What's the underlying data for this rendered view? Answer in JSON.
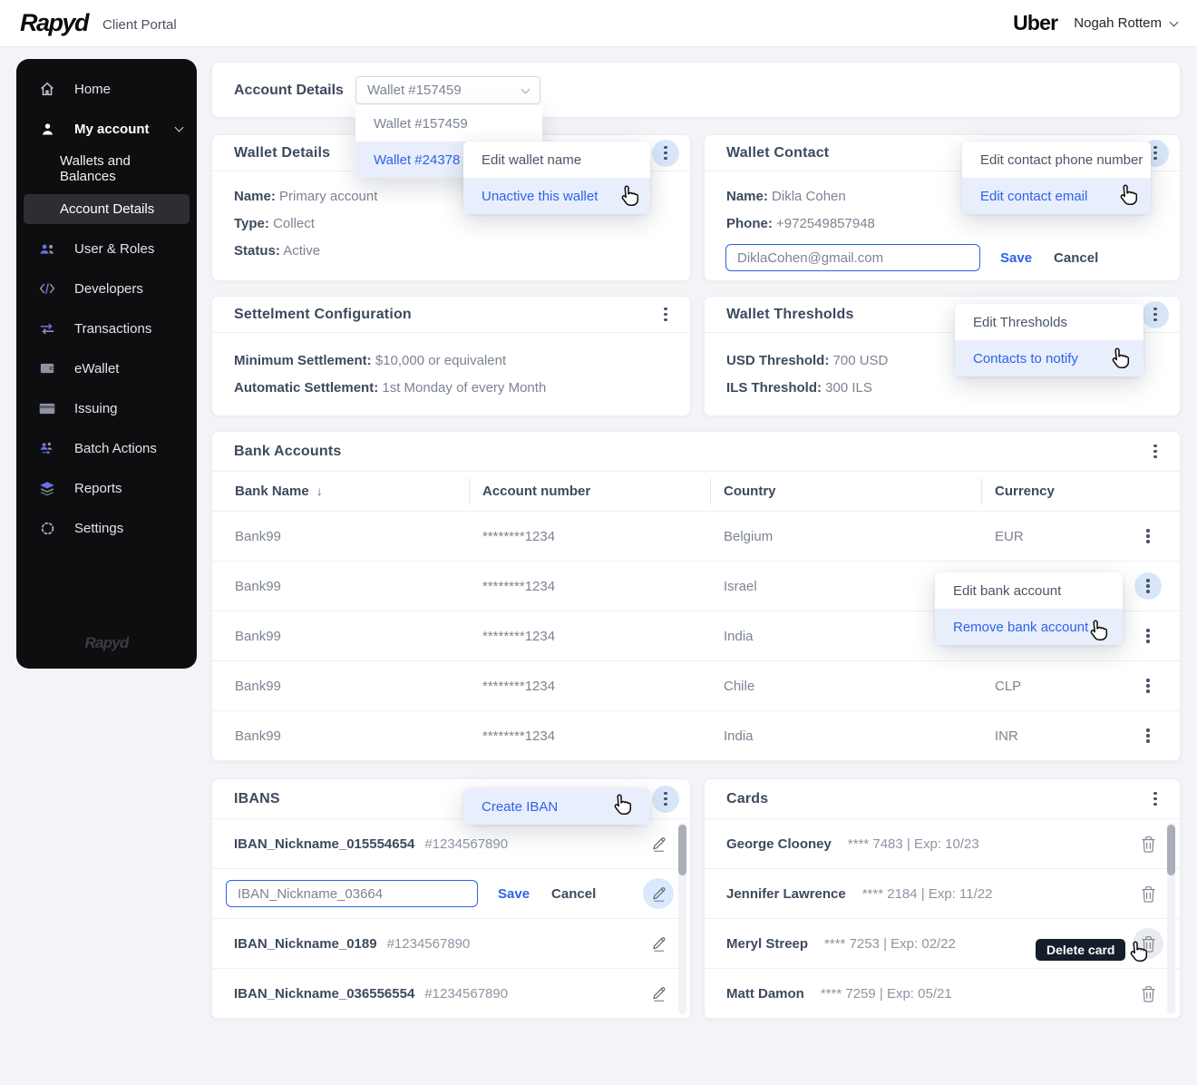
{
  "header": {
    "logo": "Rapyd",
    "portal_title": "Client Portal",
    "org_logo": "Uber",
    "user_name": "Nogah Rottem"
  },
  "sidebar": {
    "items": [
      {
        "label": "Home",
        "icon": "home-icon"
      },
      {
        "label": "My account",
        "icon": "user-icon",
        "expanded": true
      },
      {
        "label": "Wallets and Balances",
        "sub": true
      },
      {
        "label": "Account Details",
        "sub": true,
        "active": true
      },
      {
        "label": "User & Roles",
        "icon": "users-icon"
      },
      {
        "label": "Developers",
        "icon": "code-icon"
      },
      {
        "label": "Transactions",
        "icon": "transfer-icon"
      },
      {
        "label": "eWallet",
        "icon": "wallet-icon"
      },
      {
        "label": "Issuing",
        "icon": "card-icon"
      },
      {
        "label": "Batch Actions",
        "icon": "batch-icon"
      },
      {
        "label": "Reports",
        "icon": "layers-icon"
      },
      {
        "label": "Settings",
        "icon": "gear-icon"
      }
    ],
    "footer_logo": "Rapyd"
  },
  "account_details": {
    "title": "Account Details",
    "selected_wallet": "Wallet #157459",
    "options": [
      {
        "label": "Wallet #157459",
        "highlighted": false
      },
      {
        "label": "Wallet #24378",
        "highlighted": true
      }
    ]
  },
  "wallet_details": {
    "title": "Wallet Details",
    "name_label": "Name:",
    "name": "Primary account",
    "type_label": "Type:",
    "type": "Collect",
    "status_label": "Status:",
    "status": "Active",
    "menu": [
      {
        "label": "Edit wallet name",
        "highlighted": false
      },
      {
        "label": "Unactive this wallet",
        "highlighted": true
      }
    ]
  },
  "wallet_contact": {
    "title": "Wallet Contact",
    "name_label": "Name:",
    "name": "Dikla Cohen",
    "phone_label": "Phone:",
    "phone": "+972549857948",
    "email_value": "DiklaCohen@gmail.com",
    "save_label": "Save",
    "cancel_label": "Cancel",
    "menu": [
      {
        "label": "Edit contact phone number",
        "highlighted": false
      },
      {
        "label": "Edit contact email",
        "highlighted": true
      }
    ]
  },
  "settlement": {
    "title": "Settelment Configuration",
    "rows": [
      {
        "label": "Minimum Settlement:",
        "value": "$10,000 or equivalent"
      },
      {
        "label": "Automatic Settlement:",
        "value": "1st Monday of every Month"
      }
    ]
  },
  "thresholds": {
    "title": "Wallet Thresholds",
    "rows": [
      {
        "label": "USD Threshold:",
        "value": "700 USD"
      },
      {
        "label": "ILS Threshold:",
        "value": "300 ILS"
      }
    ],
    "menu": [
      {
        "label": "Edit Thresholds",
        "highlighted": false
      },
      {
        "label": "Contacts to notify",
        "highlighted": true
      }
    ]
  },
  "bank_accounts": {
    "title": "Bank Accounts",
    "columns": [
      "Bank Name",
      "Account number",
      "Country",
      "Currency"
    ],
    "sort_column": "Bank Name",
    "sort_icon": "arrow-down",
    "rows": [
      [
        "Bank99",
        "********1234",
        "Belgium",
        "EUR"
      ],
      [
        "Bank99",
        "********1234",
        "Israel",
        ""
      ],
      [
        "Bank99",
        "********1234",
        "India",
        ""
      ],
      [
        "Bank99",
        "********1234",
        "Chile",
        "CLP"
      ],
      [
        "Bank99",
        "********1234",
        "India",
        "INR"
      ]
    ],
    "menu": [
      {
        "label": "Edit bank account",
        "highlighted": false
      },
      {
        "label": "Remove bank account",
        "highlighted": true
      }
    ]
  },
  "ibans": {
    "title": "IBANS",
    "menu": [
      {
        "label": "Create IBAN",
        "highlighted": true
      }
    ],
    "items": [
      {
        "nickname": "IBAN_Nickname_015554654",
        "number": "#1234567890"
      },
      {
        "editing": true,
        "input_value": "IBAN_Nickname_03664",
        "save_label": "Save",
        "cancel_label": "Cancel"
      },
      {
        "nickname": "IBAN_Nickname_0189",
        "number": "#1234567890"
      },
      {
        "nickname": "IBAN_Nickname_036556554",
        "number": "#1234567890"
      }
    ]
  },
  "cards": {
    "title": "Cards",
    "items": [
      {
        "name": "George Clooney",
        "details": "**** 7483 | Exp: 10/23"
      },
      {
        "name": "Jennifer Lawrence",
        "details": "**** 2184 | Exp: 11/22"
      },
      {
        "name": "Meryl Streep",
        "details": "**** 7253 | Exp: 02/22",
        "tooltip": "Delete card"
      },
      {
        "name": "Matt Damon",
        "details": "**** 7259 | Exp: 05/21"
      }
    ]
  },
  "theme": {
    "accent_blue": "#2e62e9",
    "menu_highlight_bg": "#e8eefb",
    "kebab_active_bg": "#d9e6fa",
    "sidebar_bg": "#0e0e10",
    "tooltip_bg": "#141e2c",
    "page_bg": "#f3f4f7",
    "text_dark": "#3d4a5e",
    "text_gray": "#7b8492"
  }
}
